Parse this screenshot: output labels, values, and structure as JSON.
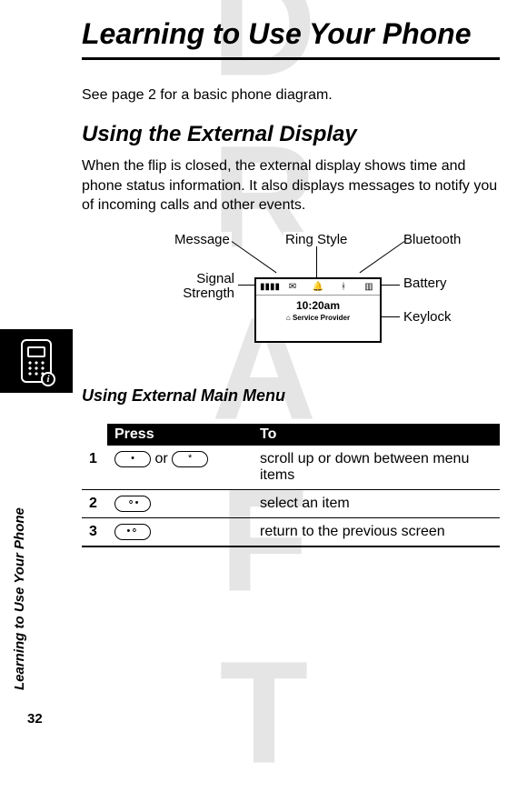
{
  "watermark": "DRAFT",
  "chapter_title": "Learning to Use Your Phone",
  "intro_text": "See page 2 for a basic phone diagram.",
  "section_title": "Using the External Display",
  "section_body": "When the flip is closed, the external display shows time and phone status information. It also displays messages to notify you of incoming calls and other events.",
  "diagram": {
    "labels": {
      "message": "Message",
      "ring_style": "Ring Style",
      "bluetooth": "Bluetooth",
      "signal_strength": "Signal Strength",
      "battery": "Battery",
      "keylock": "Keylock"
    },
    "display": {
      "time": "10:20am",
      "provider": "Service Provider",
      "icons": {
        "signal": "▮▮▮▮",
        "message": "✉",
        "ring": "🔔",
        "bluetooth": "ᚼ",
        "battery": "▥"
      },
      "keylock_icon": "⌂"
    }
  },
  "subsection_title": "Using External Main Menu",
  "table": {
    "headers": {
      "press": "Press",
      "to": "To"
    },
    "rows": [
      {
        "step": "1",
        "press_keys": [
          "•",
          "*"
        ],
        "press_join": " or ",
        "to": "scroll up or down between menu items"
      },
      {
        "step": "2",
        "press_keys": [
          "⚬•"
        ],
        "press_join": "",
        "to": "select an item"
      },
      {
        "step": "3",
        "press_keys": [
          "•⚬"
        ],
        "press_join": "",
        "to": "return to the previous screen"
      }
    ]
  },
  "side_title": "Learning to Use Your Phone",
  "page_number": "32"
}
